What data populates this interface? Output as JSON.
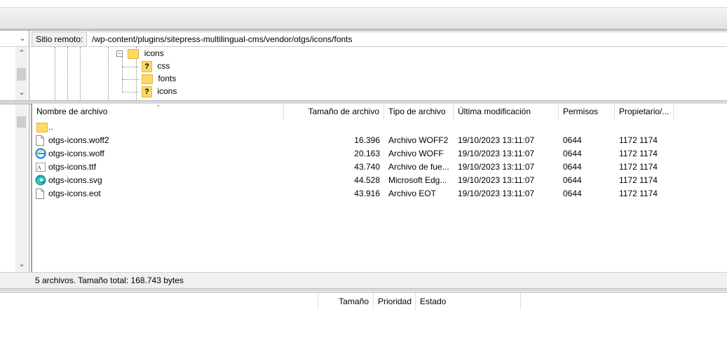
{
  "remote": {
    "label": "Sitio remoto:",
    "path": "/wp-content/plugins/sitepress-multilingual-cms/vendor/otgs/icons/fonts"
  },
  "tree": {
    "nodes": [
      {
        "name": "icons",
        "icon": "folder-icon",
        "expanded": true
      },
      {
        "name": "css",
        "icon": "unknown-folder-icon"
      },
      {
        "name": "fonts",
        "icon": "folder-icon",
        "selected": true
      },
      {
        "name": "icons",
        "icon": "unknown-folder-icon"
      }
    ]
  },
  "columns": {
    "name": "Nombre de archivo",
    "size": "Tamaño de archivo",
    "type": "Tipo de archivo",
    "modified": "Última modificación",
    "perms": "Permisos",
    "owner": "Propietario/..."
  },
  "files": [
    {
      "name": "..",
      "icon": "parent-folder-icon",
      "size": "",
      "type": "",
      "modified": "",
      "perms": "",
      "owner": ""
    },
    {
      "name": "otgs-icons.woff2",
      "icon": "blank-file-icon",
      "size": "16.396",
      "type": "Archivo WOFF2",
      "modified": "19/10/2023 13:11:07",
      "perms": "0644",
      "owner": "1172 1174"
    },
    {
      "name": "otgs-icons.woff",
      "icon": "internet-explorer-icon",
      "size": "20.163",
      "type": "Archivo WOFF",
      "modified": "19/10/2023 13:11:07",
      "perms": "0644",
      "owner": "1172 1174"
    },
    {
      "name": "otgs-icons.ttf",
      "icon": "font-file-icon",
      "size": "43.740",
      "type": "Archivo de fue...",
      "modified": "19/10/2023 13:11:07",
      "perms": "0644",
      "owner": "1172 1174"
    },
    {
      "name": "otgs-icons.svg",
      "icon": "edge-browser-icon",
      "size": "44.528",
      "type": "Microsoft Edg...",
      "modified": "19/10/2023 13:11:07",
      "perms": "0644",
      "owner": "1172 1174"
    },
    {
      "name": "otgs-icons.eot",
      "icon": "blank-file-icon",
      "size": "43.916",
      "type": "Archivo EOT",
      "modified": "19/10/2023 13:11:07",
      "perms": "0644",
      "owner": "1172 1174"
    }
  ],
  "status": "5 archivos. Tamaño total: 168.743 bytes",
  "queue": {
    "size": "Tamaño",
    "priority": "Prioridad",
    "state": "Estado"
  },
  "colors": {
    "folder": "#ffd866",
    "chrome": "#f0f0f0",
    "border": "#a0a0a0"
  }
}
